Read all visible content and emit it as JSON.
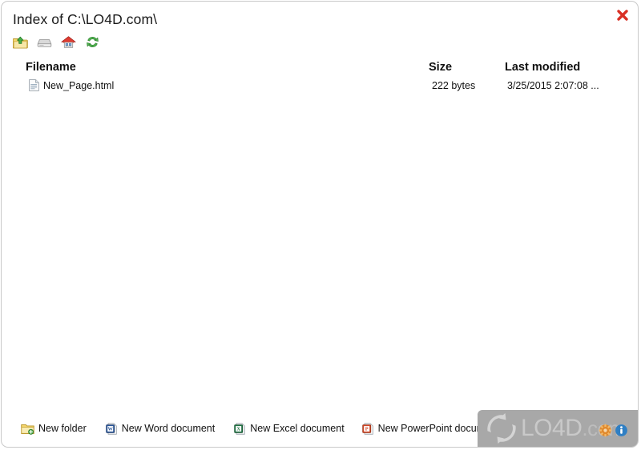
{
  "window": {
    "title": "Index of C:\\LO4D.com\\",
    "close_label": "×"
  },
  "toolbar": {
    "items": [
      {
        "name": "up-folder-icon",
        "tooltip": "Up one level"
      },
      {
        "name": "drive-icon",
        "tooltip": "Drives"
      },
      {
        "name": "home-icon",
        "tooltip": "Home"
      },
      {
        "name": "refresh-icon",
        "tooltip": "Refresh"
      }
    ]
  },
  "table": {
    "headers": {
      "filename": "Filename",
      "size": "Size",
      "modified": "Last modified"
    },
    "rows": [
      {
        "icon": "html-file-icon",
        "filename": "New_Page.html",
        "size": "222 bytes",
        "modified": "3/25/2015 2:07:08 ..."
      }
    ]
  },
  "bottom_bar": {
    "actions": [
      {
        "icon": "new-folder-icon",
        "label": "New folder"
      },
      {
        "icon": "word-document-icon",
        "label": "New Word document"
      },
      {
        "icon": "excel-document-icon",
        "label": "New Excel document"
      },
      {
        "icon": "powerpoint-document-icon",
        "label": "New PowerPoint document"
      }
    ]
  },
  "watermark": {
    "brand": "LO4D",
    "suffix": ".com"
  },
  "colors": {
    "close_red": "#d93025",
    "folder_yellow": "#f2c14b",
    "word_blue": "#2a5699",
    "excel_green": "#217346",
    "powerpoint_orange": "#d24726",
    "refresh_green": "#3fae3f",
    "watermark_bg": "#a8a8a8",
    "border": "#c9c9c9"
  }
}
